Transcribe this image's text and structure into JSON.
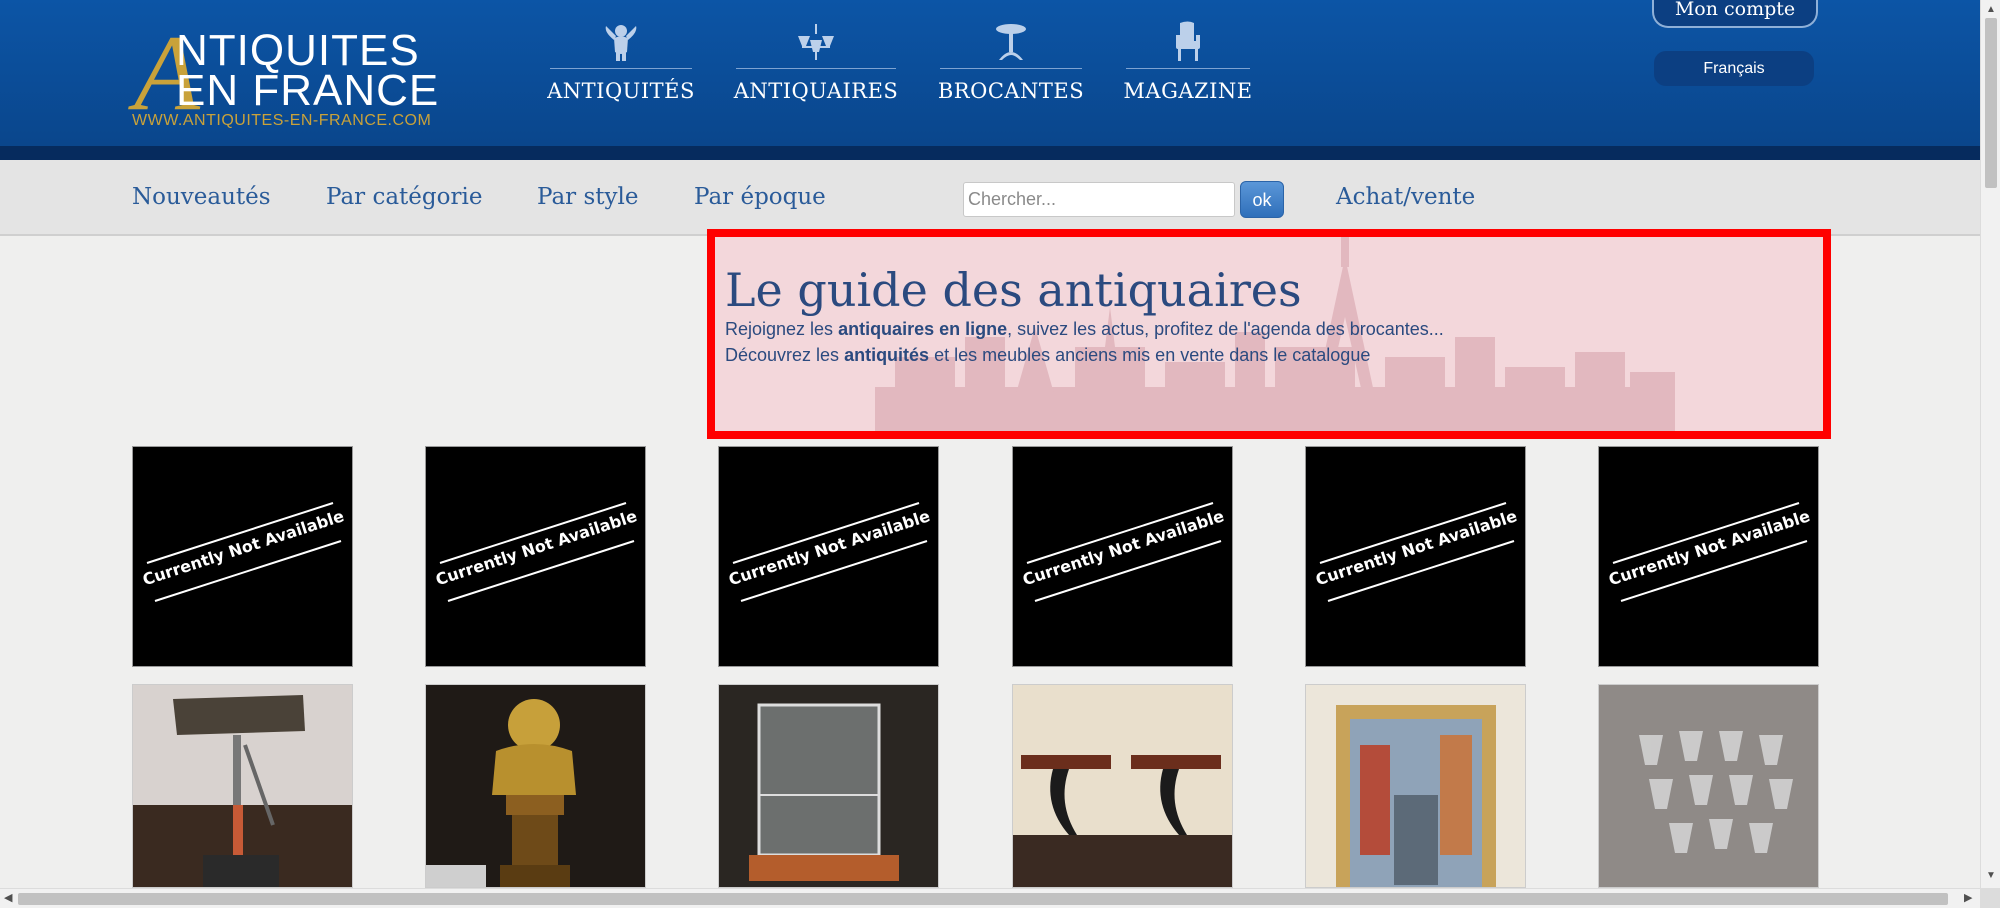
{
  "header": {
    "logo": {
      "initial": "A",
      "line1": "NTIQUITES",
      "line2": "EN FRANCE",
      "url": "WWW.ANTIQUITES-EN-FRANCE.COM"
    },
    "nav": [
      {
        "label": "ANTIQUITÉS",
        "icon": "cherub-icon"
      },
      {
        "label": "ANTIQUAIRES",
        "icon": "chandelier-icon"
      },
      {
        "label": "BROCANTES",
        "icon": "pedestal-table-icon"
      },
      {
        "label": "MAGAZINE",
        "icon": "armchair-icon"
      }
    ],
    "account_label": "Mon compte",
    "language_label": "Français"
  },
  "subnav": {
    "links": [
      "Nouveautés",
      "Par catégorie",
      "Par style",
      "Par époque"
    ],
    "search_placeholder": "Chercher...",
    "search_button": "ok",
    "achat_vente": "Achat/vente"
  },
  "banner": {
    "title": "Le guide des antiquaires",
    "line1": {
      "before": "Rejoignez les ",
      "bold": "antiquaires en ligne",
      "after": ", suivez les actus, profitez de l'agenda des brocantes..."
    },
    "line2": {
      "before": "Découvrez les ",
      "bold": "antiquités",
      "after": " et les meubles anciens mis en vente dans le catalogue"
    },
    "highlight_color": "#ff0000"
  },
  "grid": {
    "unavailable_text": "Currently Not Available",
    "row1_count": 6,
    "row2_items": [
      "lamp-photo",
      "bust-photo",
      "display-case-photo",
      "wall-consoles-photo",
      "painting-photo",
      "glasses-photo"
    ]
  },
  "colors": {
    "header_blue": "#0b4a94",
    "gold": "#c9a23a",
    "link_blue": "#2a5b99",
    "text_blue": "#2b4a7f"
  }
}
